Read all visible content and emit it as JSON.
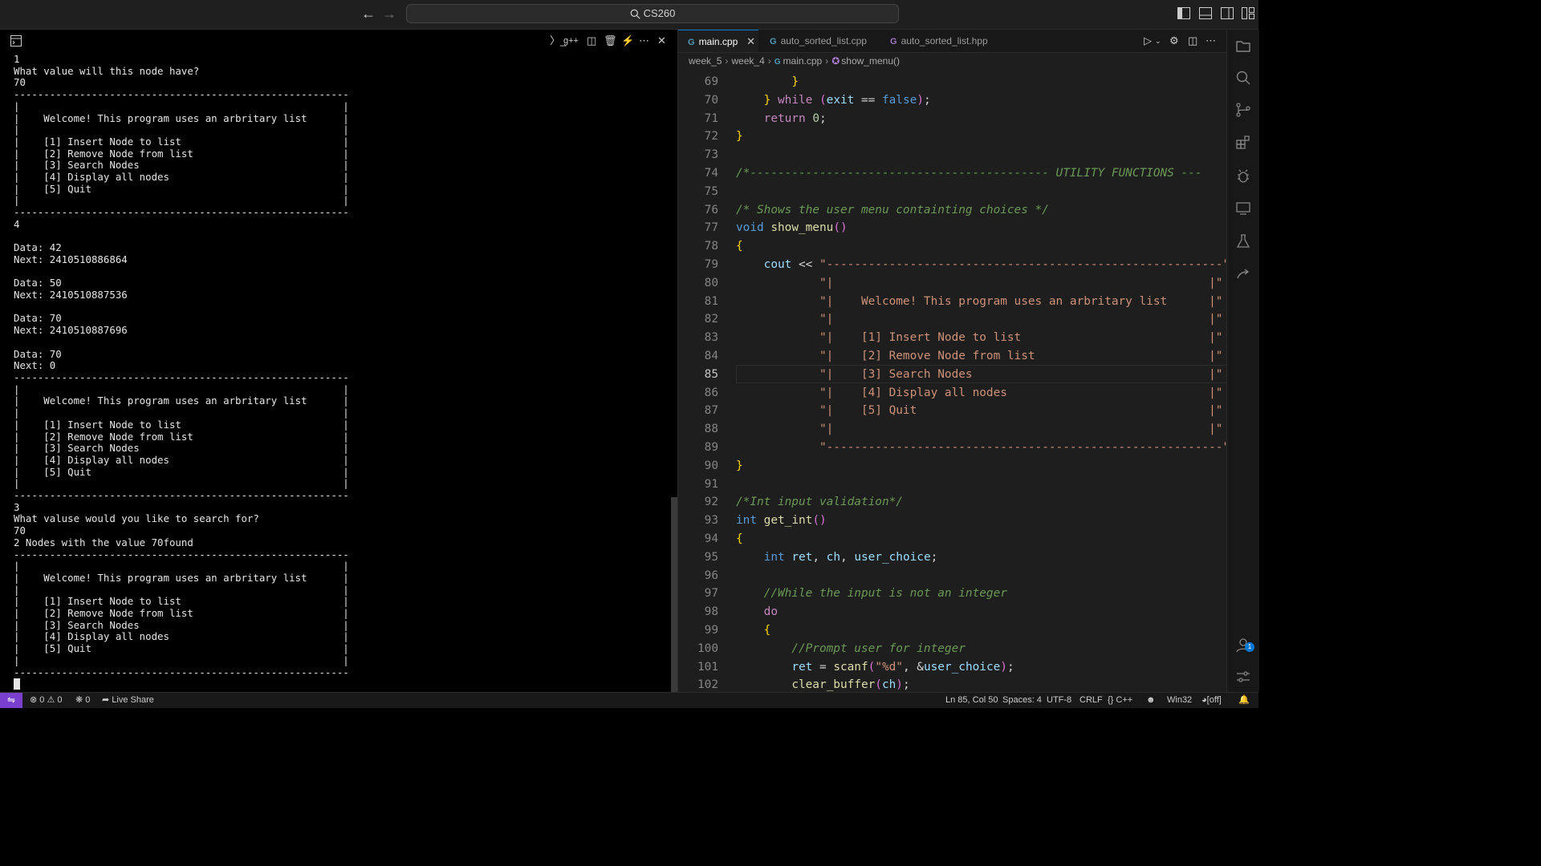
{
  "titlebar": {
    "search_text": "CS260"
  },
  "terminal": {
    "task_label": "g++",
    "output": "1\nWhat value will this node have?\n70\n--------------------------------------------------------\n|                                                      |\n|    Welcome! This program uses an arbritary list      |\n|                                                      |\n|    [1] Insert Node to list                           |\n|    [2] Remove Node from list                         |\n|    [3] Search Nodes                                  |\n|    [4] Display all nodes                             |\n|    [5] Quit                                          |\n|                                                      |\n--------------------------------------------------------\n4\n\nData: 42\nNext: 2410510886864\n\nData: 50\nNext: 2410510887536\n\nData: 70\nNext: 2410510887696\n\nData: 70\nNext: 0\n--------------------------------------------------------\n|                                                      |\n|    Welcome! This program uses an arbritary list      |\n|                                                      |\n|    [1] Insert Node to list                           |\n|    [2] Remove Node from list                         |\n|    [3] Search Nodes                                  |\n|    [4] Display all nodes                             |\n|    [5] Quit                                          |\n|                                                      |\n--------------------------------------------------------\n3\nWhat valuse would you like to search for?\n70\n2 Nodes with the value 70found\n--------------------------------------------------------\n|                                                      |\n|    Welcome! This program uses an arbritary list      |\n|                                                      |\n|    [1] Insert Node to list                           |\n|    [2] Remove Node from list                         |\n|    [3] Search Nodes                                  |\n|    [4] Display all nodes                             |\n|    [5] Quit                                          |\n|                                                      |\n--------------------------------------------------------\n"
  },
  "editor": {
    "tabs": [
      {
        "label": "main.cpp",
        "active": true
      },
      {
        "label": "auto_sorted_list.cpp",
        "active": false
      },
      {
        "label": "auto_sorted_list.hpp",
        "active": false
      }
    ],
    "breadcrumbs": [
      "week_5",
      "week_4",
      "main.cpp",
      "show_menu()"
    ],
    "current_line": 85,
    "lines": [
      {
        "n": "69",
        "text": "        }"
      },
      {
        "n": "70",
        "text": "    } while (exit == false);"
      },
      {
        "n": "71",
        "text": "    return 0;"
      },
      {
        "n": "72",
        "text": "}"
      },
      {
        "n": "73",
        "text": ""
      },
      {
        "n": "74",
        "text": "/*------------------------------------------- UTILITY FUNCTIONS ---"
      },
      {
        "n": "75",
        "text": ""
      },
      {
        "n": "76",
        "text": "/* Shows the user menu containting choices */"
      },
      {
        "n": "77",
        "text": "void show_menu()"
      },
      {
        "n": "78",
        "text": "{"
      },
      {
        "n": "79",
        "text": "    cout << \"---------------------------------------------------------\""
      },
      {
        "n": "80",
        "text": "            \"|                                                      |\""
      },
      {
        "n": "81",
        "text": "            \"|    Welcome! This program uses an arbritary list      |\""
      },
      {
        "n": "82",
        "text": "            \"|                                                      |\""
      },
      {
        "n": "83",
        "text": "            \"|    [1] Insert Node to list                           |\""
      },
      {
        "n": "84",
        "text": "            \"|    [2] Remove Node from list                         |\""
      },
      {
        "n": "85",
        "text": "            \"|    [3] Search Nodes                                  |\""
      },
      {
        "n": "86",
        "text": "            \"|    [4] Display all nodes                             |\""
      },
      {
        "n": "87",
        "text": "            \"|    [5] Quit                                          |\""
      },
      {
        "n": "88",
        "text": "            \"|                                                      |\""
      },
      {
        "n": "89",
        "text": "            \"---------------------------------------------------------\""
      },
      {
        "n": "90",
        "text": "}"
      },
      {
        "n": "91",
        "text": ""
      },
      {
        "n": "92",
        "text": "/*Int input validation*/"
      },
      {
        "n": "93",
        "text": "int get_int()"
      },
      {
        "n": "94",
        "text": "{"
      },
      {
        "n": "95",
        "text": "    int ret, ch, user_choice;"
      },
      {
        "n": "96",
        "text": ""
      },
      {
        "n": "97",
        "text": "    //While the input is not an integer"
      },
      {
        "n": "98",
        "text": "    do"
      },
      {
        "n": "99",
        "text": "    {"
      },
      {
        "n": "100",
        "text": "        //Prompt user for integer"
      },
      {
        "n": "101",
        "text": "        ret = scanf(\"%d\", &user_choice);"
      },
      {
        "n": "102",
        "text": "        clear_buffer(ch);"
      }
    ]
  },
  "statusbar": {
    "errors": "0",
    "warnings": "0",
    "ports": "0",
    "live_share": "Live Share",
    "cursor_pos": "Ln 85, Col 50",
    "spaces": "Spaces: 4",
    "encoding": "UTF-8",
    "eol": "CRLF",
    "language": "C++",
    "platform": "Win32",
    "copilot": "[off]"
  },
  "activity": {
    "accounts_badge": "1"
  }
}
